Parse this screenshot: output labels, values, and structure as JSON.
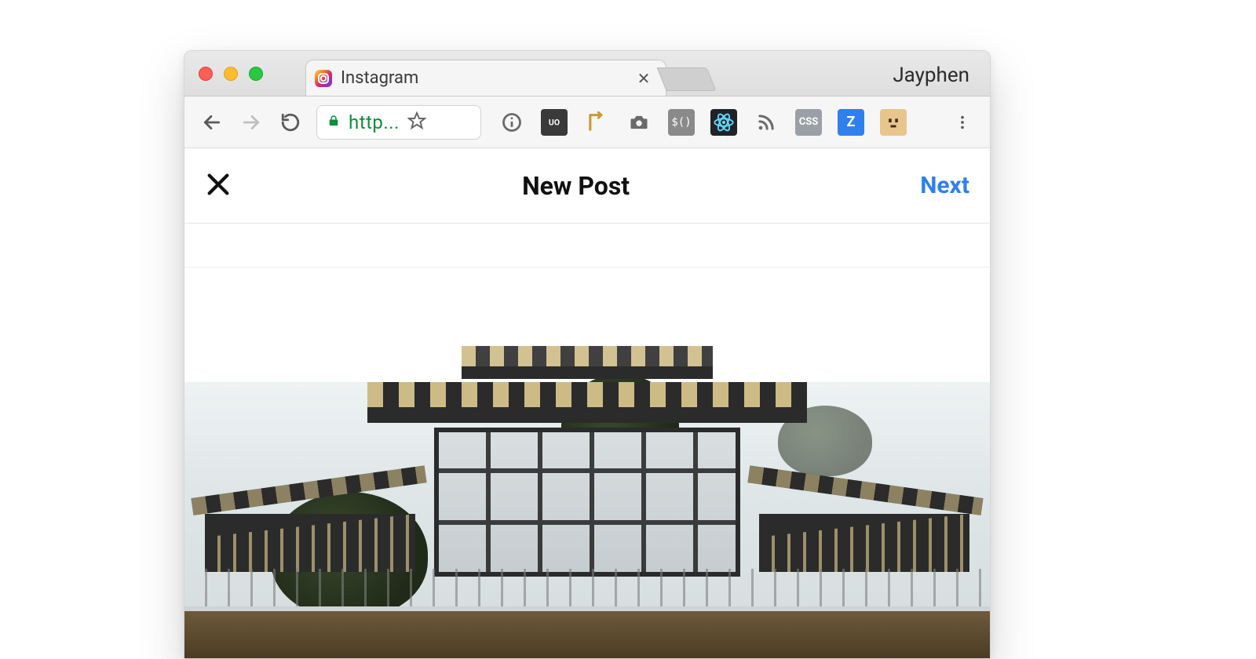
{
  "browser": {
    "profile_name": "Jayphen",
    "tab": {
      "title": "Instagram",
      "close_glyph": "✕"
    },
    "omnibox": {
      "url_display": "http..."
    },
    "extensions": {
      "jquery_label": "$()",
      "z_label": "Z",
      "css_label": "CSS"
    }
  },
  "app": {
    "header": {
      "title": "New Post",
      "next_label": "Next"
    }
  }
}
